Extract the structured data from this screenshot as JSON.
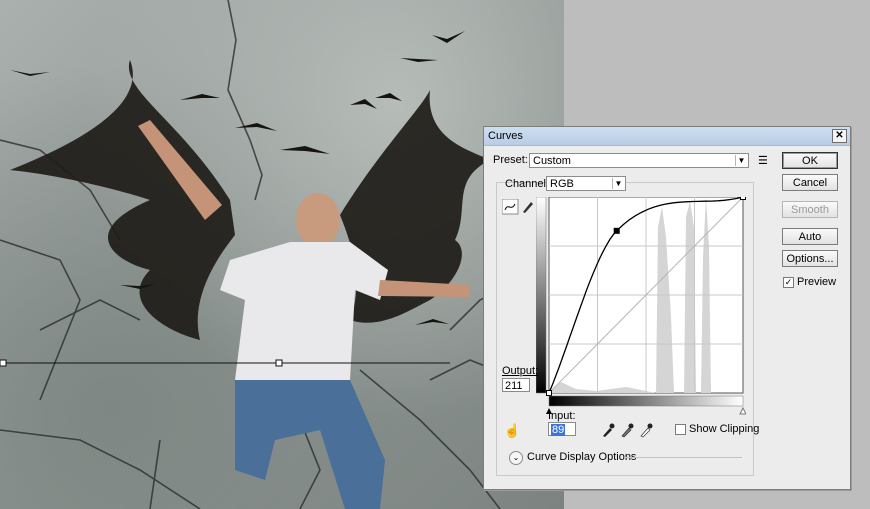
{
  "dialog": {
    "title": "Curves",
    "close": "✕",
    "preset_label": "Preset:",
    "preset_value": "Custom",
    "channel_label": "Channel:",
    "channel_value": "RGB",
    "output_label": "Output:",
    "output_value": "211",
    "input_label": "Input:",
    "input_value": "89",
    "show_clipping_label": "Show Clipping",
    "display_options_label": "Curve Display Options",
    "buttons": {
      "ok": "OK",
      "cancel": "Cancel",
      "smooth": "Smooth",
      "auto": "Auto",
      "options": "Options..."
    },
    "preview_label": "Preview",
    "preview_checked": true,
    "show_clipping_checked": false
  },
  "curve": {
    "points": [
      [
        0,
        0
      ],
      [
        89,
        211
      ],
      [
        255,
        255
      ]
    ],
    "selected_point": [
      89,
      211
    ]
  },
  "colors": {
    "titlebar": "#c4d5ea",
    "dialog_bg": "#ececec"
  }
}
